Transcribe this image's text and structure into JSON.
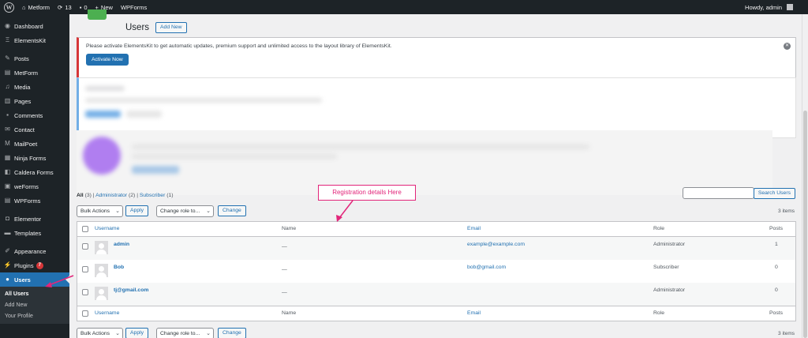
{
  "adminbar": {
    "site_name": "Metform",
    "updates_count": "13",
    "comments_count": "0",
    "new_label": "New",
    "wpforms_label": "WPForms",
    "howdy": "Howdy, admin"
  },
  "sidebar": {
    "items": [
      {
        "label": "Dashboard",
        "icon": "dashboard-icon"
      },
      {
        "label": "ElementsKit",
        "icon": "elementskit-icon"
      },
      {
        "label": "Posts",
        "icon": "pin-icon"
      },
      {
        "label": "MetForm",
        "icon": "form-icon"
      },
      {
        "label": "Media",
        "icon": "media-icon"
      },
      {
        "label": "Pages",
        "icon": "pages-icon"
      },
      {
        "label": "Comments",
        "icon": "comment-icon"
      },
      {
        "label": "Contact",
        "icon": "mail-icon"
      },
      {
        "label": "MailPoet",
        "icon": "mailpoet-icon"
      },
      {
        "label": "Ninja Forms",
        "icon": "ninja-forms-icon"
      },
      {
        "label": "Caldera Forms",
        "icon": "caldera-icon"
      },
      {
        "label": "weForms",
        "icon": "weforms-icon"
      },
      {
        "label": "WPForms",
        "icon": "wpforms-icon"
      },
      {
        "label": "Elementor",
        "icon": "elementor-icon"
      },
      {
        "label": "Templates",
        "icon": "templates-icon"
      },
      {
        "label": "Appearance",
        "icon": "brush-icon"
      },
      {
        "label": "Plugins",
        "icon": "plugin-icon",
        "badge": "7"
      },
      {
        "label": "Users",
        "icon": "user-icon"
      }
    ],
    "submenu": [
      "All Users",
      "Add New",
      "Your Profile"
    ]
  },
  "page": {
    "title": "Users",
    "add_new": "Add New"
  },
  "notice": {
    "text": "Please activate ElementsKit to get automatic updates, premium support and unlimited access to the layout library of ElementsKit.",
    "button": "Activate Now",
    "dismiss": "✕"
  },
  "filters": {
    "all": "All",
    "all_count": "(3)",
    "sep": "|",
    "administrator": "Administrator",
    "administrator_count": "(2)",
    "subscriber": "Subscriber",
    "subscriber_count": "(1)"
  },
  "search_button": "Search Users",
  "actions": {
    "bulk_actions": "Bulk Actions",
    "apply": "Apply",
    "change_role": "Change role to...",
    "change": "Change",
    "items_count": "3 items"
  },
  "table": {
    "columns": [
      "Username",
      "Name",
      "Email",
      "Role",
      "Posts"
    ],
    "rows": [
      {
        "username": "admin",
        "name": "—",
        "email": "example@example.com",
        "role": "Administrator",
        "posts": "1"
      },
      {
        "username": "Bob",
        "name": "—",
        "email": "bob@gmail.com",
        "role": "Subscriber",
        "posts": "0"
      },
      {
        "username": "tj@gmail.com",
        "name": "—",
        "email": "",
        "role": "Administrator",
        "posts": "0"
      }
    ]
  },
  "annotation": {
    "text": "Registration details Here",
    "color": "#e2257a"
  },
  "colors": {
    "accent": "#2271b1",
    "sidebar_bg": "#1d2327",
    "notice_error": "#d63638"
  }
}
